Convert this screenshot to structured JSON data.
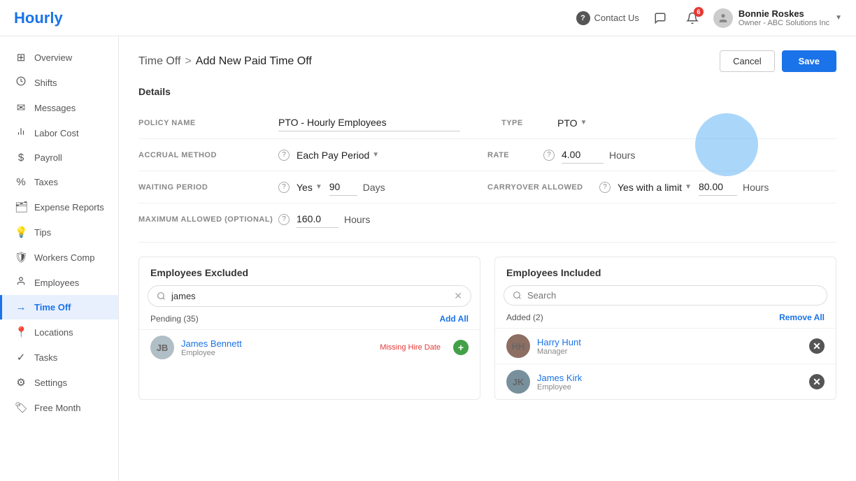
{
  "brand": "Hourly",
  "topnav": {
    "contact_label": "Contact Us",
    "notifications_count": "6",
    "user_name": "Bonnie Roskes",
    "user_company": "Owner - ABC Solutions Inc",
    "user_chevron": "▼"
  },
  "sidebar": {
    "items": [
      {
        "id": "overview",
        "label": "Overview",
        "icon": "⊞"
      },
      {
        "id": "shifts",
        "label": "Shifts",
        "icon": "⏰"
      },
      {
        "id": "messages",
        "label": "Messages",
        "icon": "✉"
      },
      {
        "id": "labor-cost",
        "label": "Labor Cost",
        "icon": "📊"
      },
      {
        "id": "payroll",
        "label": "Payroll",
        "icon": "$"
      },
      {
        "id": "taxes",
        "label": "Taxes",
        "icon": "%"
      },
      {
        "id": "expense-reports",
        "label": "Expense Reports",
        "icon": "🗂"
      },
      {
        "id": "tips",
        "label": "Tips",
        "icon": "💡"
      },
      {
        "id": "workers-comp",
        "label": "Workers Comp",
        "icon": "🛡"
      },
      {
        "id": "employees",
        "label": "Employees",
        "icon": "👤"
      },
      {
        "id": "time-off",
        "label": "Time Off",
        "icon": "→",
        "active": true
      },
      {
        "id": "locations",
        "label": "Locations",
        "icon": "📍"
      },
      {
        "id": "tasks",
        "label": "Tasks",
        "icon": "✓"
      },
      {
        "id": "settings",
        "label": "Settings",
        "icon": "⚙"
      },
      {
        "id": "free-month",
        "label": "Free Month",
        "icon": "🏷"
      }
    ]
  },
  "page": {
    "breadcrumb_link": "Time Off",
    "breadcrumb_sep": ">",
    "breadcrumb_current": "Add New Paid Time Off",
    "cancel_label": "Cancel",
    "save_label": "Save"
  },
  "details": {
    "section_title": "Details",
    "fields": {
      "policy_name_label": "POLICY NAME",
      "policy_name_value": "PTO - Hourly Employees",
      "type_label": "TYPE",
      "type_value": "PTO",
      "accrual_method_label": "ACCRUAL METHOD",
      "accrual_method_value": "Each Pay Period",
      "rate_label": "RATE",
      "rate_value": "4.00",
      "rate_unit": "Hours",
      "waiting_period_label": "WAITING PERIOD",
      "waiting_period_yes": "Yes",
      "waiting_period_days_value": "90",
      "waiting_period_unit": "Days",
      "carryover_label": "CARRYOVER ALLOWED",
      "carryover_value": "Yes with a limit",
      "carryover_hours_value": "80.00",
      "carryover_unit": "Hours",
      "max_allowed_label": "MAXIMUM ALLOWED (OPTIONAL)",
      "max_allowed_value": "160.0",
      "max_allowed_unit": "Hours"
    }
  },
  "employees_excluded": {
    "title": "Employees Excluded",
    "search_value": "james",
    "search_placeholder": "Search",
    "pending_label": "Pending (35)",
    "add_all_label": "Add All",
    "employees": [
      {
        "name": "James Bennett",
        "role": "Employee",
        "status": "Missing Hire Date",
        "initials": "JB",
        "color": "#b0bec5"
      }
    ]
  },
  "employees_included": {
    "title": "Employees Included",
    "search_value": "",
    "search_placeholder": "Search",
    "added_label": "Added (2)",
    "remove_all_label": "Remove All",
    "employees": [
      {
        "name": "Harry Hunt",
        "role": "Manager",
        "initials": "HH",
        "color": "#8d6e63"
      },
      {
        "name": "James Kirk",
        "role": "Employee",
        "initials": "JK",
        "color": "#78909c"
      }
    ]
  }
}
